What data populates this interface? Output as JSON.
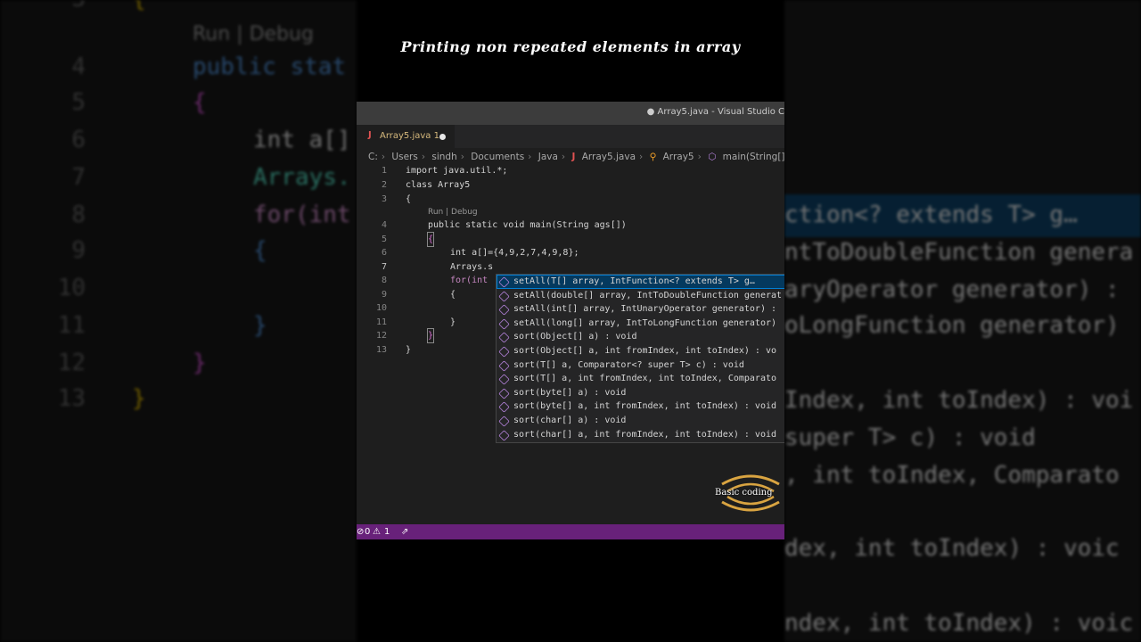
{
  "video_title": "Printing non repeated elements in array",
  "window": {
    "title": "● Array5.java - Visual Studio C"
  },
  "tab": {
    "icon": "J",
    "label": "Array5.java 1"
  },
  "breadcrumb": [
    "C:",
    "Users",
    "sindh",
    "Documents",
    "Java",
    "Array5.java",
    "Array5",
    "main(String[])"
  ],
  "codelens": "Run | Debug",
  "lines": [
    {
      "n": "1",
      "text": "import java.util.*;"
    },
    {
      "n": "2",
      "text": "class Array5"
    },
    {
      "n": "3",
      "text": "{"
    },
    {
      "n": "4",
      "text": "public static void main(String ags[])"
    },
    {
      "n": "5",
      "text": "{"
    },
    {
      "n": "6",
      "text": "int a[]={4,9,2,7,4,9,8};"
    },
    {
      "n": "7",
      "text": "Arrays.s"
    },
    {
      "n": "8",
      "text": "for(int"
    },
    {
      "n": "9",
      "text": "{"
    },
    {
      "n": "10",
      "text": ""
    },
    {
      "n": "11",
      "text": "}"
    },
    {
      "n": "12",
      "text": "}"
    },
    {
      "n": "13",
      "text": "}"
    }
  ],
  "suggestions": [
    "setAll(T[] array, IntFunction<? extends T> g…",
    "setAll(double[] array, IntToDoubleFunction generat",
    "setAll(int[] array, IntUnaryOperator generator) :",
    "setAll(long[] array, IntToLongFunction generator)",
    "sort(Object[] a) : void",
    "sort(Object[] a, int fromIndex, int toIndex) : vo",
    "sort(T[] a, Comparator<? super T> c) : void",
    "sort(T[] a, int fromIndex, int toIndex, Comparato",
    "sort(byte[] a) : void",
    "sort(byte[] a, int fromIndex, int toIndex) : void",
    "sort(char[] a) : void",
    "sort(char[] a, int fromIndex, int toIndex) : void"
  ],
  "status": {
    "errors": "0",
    "warnings": "1"
  },
  "watermark": "Basic coding",
  "bg_left": {
    "codelens": "Run | Debug",
    "line_numbers": [
      "3",
      "4",
      "5",
      "6",
      "7",
      "8",
      "9",
      "10",
      "11",
      "12",
      "13"
    ],
    "code": [
      "{",
      "public stat",
      "{",
      "int a[]",
      "Arrays.",
      "for(int",
      "{",
      "",
      "}",
      "}",
      "}"
    ]
  },
  "bg_right": [
    "ction<? extends T> g…",
    "ntToDoubleFunction genera",
    "aryOperator generator) :",
    "oLongFunction generator)",
    "",
    "Index, int toIndex) : voi",
    "super T> c) : void",
    ", int toIndex, Comparato",
    "",
    "dex, int toIndex) : voic",
    "",
    "ndex, int toIndex) : voic"
  ]
}
